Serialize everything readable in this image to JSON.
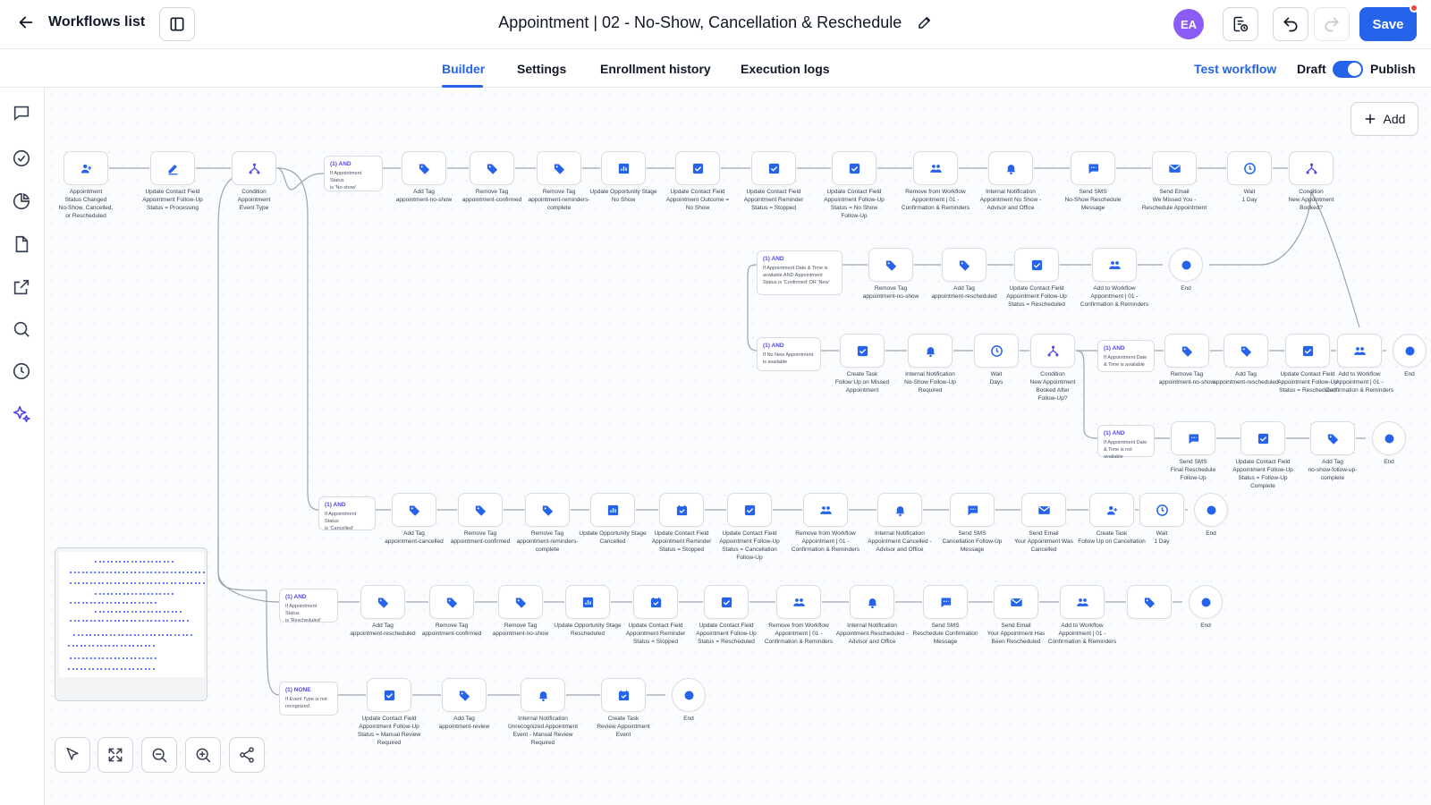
{
  "header": {
    "back_label": "Workflows list",
    "title": "Appointment | 02 - No-Show, Cancellation & Reschedule",
    "avatar_initials": "EA",
    "save_label": "Save"
  },
  "tabs": [
    {
      "label": "Builder",
      "active": true
    },
    {
      "label": "Settings",
      "active": false
    },
    {
      "label": "Enrollment history",
      "active": false
    },
    {
      "label": "Execution logs",
      "active": false
    }
  ],
  "actions": {
    "test_workflow": "Test workflow",
    "draft_label": "Draft",
    "publish_label": "Publish",
    "publish_toggle_on": true
  },
  "canvas": {
    "add_label": "Add"
  },
  "colors": {
    "accent": "#2563eb",
    "node_icon": "#2563eb",
    "condition": "#4f46e5",
    "avatar": "#8b5cf6",
    "notification_dot": "#ef4444"
  },
  "nodes": {
    "trigger": {
      "icon": "user-icon",
      "lines": [
        "Appointment",
        "Status Changed",
        "No-Show, Cancelled,",
        "or Rescheduled"
      ]
    },
    "set_processing": {
      "icon": "pencil-icon",
      "lines": [
        "Update Contact Field",
        "Appointment Follow-Up",
        "Status = Processing"
      ]
    },
    "cond_main": {
      "icon": "branch-icon",
      "lines": [
        "Condition",
        "Appointment",
        "Event Type"
      ]
    },
    "r1_cond": {
      "head": "(1) AND",
      "body": [
        "If Appointment Status",
        "is 'No-show'"
      ]
    },
    "r1": [
      {
        "icon": "tag-icon",
        "lines": [
          "Add Tag",
          "appointment-no-show"
        ]
      },
      {
        "icon": "tag-icon",
        "lines": [
          "Remove Tag",
          "appointment-confirmed"
        ]
      },
      {
        "icon": "tag-icon",
        "lines": [
          "Remove Tag",
          "appointment-reminders-",
          "complete"
        ]
      },
      {
        "icon": "chart-icon",
        "lines": [
          "Update Opportunity Stage",
          "No Show"
        ]
      },
      {
        "icon": "checkbox-icon",
        "lines": [
          "Update Contact Field",
          "Appointment Outcome =",
          "No Show"
        ]
      },
      {
        "icon": "checkbox-icon",
        "lines": [
          "Update Contact Field",
          "Appointment Reminder",
          "Status = Stopped"
        ]
      },
      {
        "icon": "checkbox-icon",
        "lines": [
          "Update Contact Field",
          "Appointment Follow-Up",
          "Status = No Show",
          "Follow-Up"
        ]
      },
      {
        "icon": "users-icon",
        "lines": [
          "Remove from Workflow",
          "Appointment | 01 -",
          "Confirmation & Reminders"
        ]
      },
      {
        "icon": "bell-icon",
        "lines": [
          "Internal Notification",
          "Appointment No Show -",
          "Advisor and Office"
        ]
      },
      {
        "icon": "sms-icon",
        "lines": [
          "Send SMS",
          "No-Show Reschedule",
          "Message"
        ]
      },
      {
        "icon": "mail-icon",
        "lines": [
          "Send Email",
          "We Missed You -",
          "Reschedule Appointment"
        ]
      },
      {
        "icon": "clock-icon",
        "lines": [
          "Wait",
          "1 Day"
        ]
      },
      {
        "icon": "branch-icon",
        "lines": [
          "Condition",
          "New Appointment",
          "Booked?"
        ]
      }
    ],
    "r2_cond": {
      "head": "(1) AND",
      "body": [
        "If Appointment Date & Time is",
        "available AND Appointment",
        "Status is 'Confirmed' OR 'New'"
      ]
    },
    "r2": [
      {
        "icon": "tag-icon",
        "lines": [
          "Remove Tag",
          "appointment-no-show"
        ]
      },
      {
        "icon": "tag-icon",
        "lines": [
          "Add Tag",
          "appointment-rescheduled"
        ]
      },
      {
        "icon": "checkbox-icon",
        "lines": [
          "Update Contact Field",
          "Appointment Follow-Up",
          "Status = Rescheduled"
        ]
      },
      {
        "icon": "users-icon",
        "lines": [
          "Add to Workflow",
          "Appointment | 01 -",
          "Confirmation & Reminders"
        ]
      },
      {
        "icon": "end-icon",
        "lines": [
          "End"
        ]
      }
    ],
    "r3_cond": {
      "head": "(1) AND",
      "body": [
        "If No New Appointment",
        "is available"
      ]
    },
    "r3": [
      {
        "icon": "checkbox-icon",
        "lines": [
          "Create Task",
          "Follow Up on Missed",
          "Appointment"
        ]
      },
      {
        "icon": "bell-icon",
        "lines": [
          "Internal Notification",
          "No-Show Follow-Up",
          "Required"
        ]
      },
      {
        "icon": "clock-icon",
        "lines": [
          "Wait",
          "Days"
        ]
      },
      {
        "icon": "branch-icon",
        "lines": [
          "Condition",
          "New Appointment",
          "Booked After",
          "Follow-Up?"
        ]
      }
    ],
    "r3a_cond": {
      "head": "(1) AND",
      "body": [
        "If Appointment Date",
        "& Time is available"
      ]
    },
    "r3a": [
      {
        "icon": "tag-icon",
        "lines": [
          "Remove Tag",
          "appointment-no-show"
        ]
      },
      {
        "icon": "tag-icon",
        "lines": [
          "Add Tag",
          "appointment-rescheduled"
        ]
      },
      {
        "icon": "checkbox-icon",
        "lines": [
          "Update Contact Field",
          "Appointment Follow-Up",
          "Status = Rescheduled"
        ]
      },
      {
        "icon": "users-icon",
        "lines": [
          "Add to Workflow",
          "Appointment | 01 -",
          "Confirmation & Reminders"
        ]
      },
      {
        "icon": "end-icon",
        "lines": [
          "End"
        ]
      }
    ],
    "r3b_cond": {
      "head": "(1) AND",
      "body": [
        "If Appointment Date",
        "& Time is not available"
      ]
    },
    "r3b": [
      {
        "icon": "sms-icon",
        "lines": [
          "Send SMS",
          "Final Reschedule",
          "Follow-Up"
        ]
      },
      {
        "icon": "checkbox-icon",
        "lines": [
          "Update Contact Field",
          "Appointment Follow-Up",
          "Status = Follow-Up",
          "Complete"
        ]
      },
      {
        "icon": "tag-icon",
        "lines": [
          "Add Tag",
          "no-show-follow-up-",
          "complete"
        ]
      },
      {
        "icon": "end-icon",
        "lines": [
          "End"
        ]
      }
    ],
    "r4_cond": {
      "head": "(1) AND",
      "body": [
        "If Appointment Status",
        "is 'Cancelled'"
      ]
    },
    "r4": [
      {
        "icon": "tag-icon",
        "lines": [
          "Add Tag",
          "appointment-cancelled"
        ]
      },
      {
        "icon": "tag-icon",
        "lines": [
          "Remove Tag",
          "appointment-confirmed"
        ]
      },
      {
        "icon": "tag-icon",
        "lines": [
          "Remove Tag",
          "appointment-reminders-",
          "complete"
        ]
      },
      {
        "icon": "chart-icon",
        "lines": [
          "Update Opportunity Stage",
          "Cancelled"
        ]
      },
      {
        "icon": "calendar-icon",
        "lines": [
          "Update Contact Field",
          "Appointment Reminder",
          "Status = Stopped"
        ]
      },
      {
        "icon": "checkbox-icon",
        "lines": [
          "Update Contact Field",
          "Appointment Follow-Up",
          "Status = Cancellation",
          "Follow-Up"
        ]
      },
      {
        "icon": "users-icon",
        "lines": [
          "Remove from Workflow",
          "Appointment | 01 -",
          "Confirmation & Reminders"
        ]
      },
      {
        "icon": "bell-icon",
        "lines": [
          "Internal Notification",
          "Appointment Cancelled -",
          "Advisor and Office"
        ]
      },
      {
        "icon": "sms-icon",
        "lines": [
          "Send SMS",
          "Cancellation Follow-Up",
          "Message"
        ]
      },
      {
        "icon": "mail-icon",
        "lines": [
          "Send Email",
          "Your Appointment Was",
          "Cancelled"
        ]
      },
      {
        "icon": "user-icon",
        "lines": [
          "Create Task",
          "Follow Up on Cancellation"
        ]
      },
      {
        "icon": "clock-icon",
        "lines": [
          "Wait",
          "1 Day"
        ]
      },
      {
        "icon": "end-icon",
        "lines": [
          "End"
        ]
      }
    ],
    "r5_cond": {
      "head": "(1) AND",
      "body": [
        "If Appointment Status",
        "is 'Rescheduled'"
      ]
    },
    "r5": [
      {
        "icon": "tag-icon",
        "lines": [
          "Add Tag",
          "appointment-rescheduled"
        ]
      },
      {
        "icon": "tag-icon",
        "lines": [
          "Remove Tag",
          "appointment-confirmed"
        ]
      },
      {
        "icon": "tag-icon",
        "lines": [
          "Remove Tag",
          "appointment-no-show"
        ]
      },
      {
        "icon": "chart-icon",
        "lines": [
          "Update Opportunity Stage",
          "Rescheduled"
        ]
      },
      {
        "icon": "calendar-icon",
        "lines": [
          "Update Contact Field",
          "Appointment Reminder",
          "Status = Stopped"
        ]
      },
      {
        "icon": "checkbox-icon",
        "lines": [
          "Update Contact Field",
          "Appointment Follow-Up",
          "Status = Rescheduled"
        ]
      },
      {
        "icon": "users-icon",
        "lines": [
          "Remove from Workflow",
          "Appointment | 01 -",
          "Confirmation & Reminders"
        ]
      },
      {
        "icon": "bell-icon",
        "lines": [
          "Internal Notification",
          "Appointment Rescheduled -",
          "Advisor and Office"
        ]
      },
      {
        "icon": "sms-icon",
        "lines": [
          "Send SMS",
          "Reschedule Confirmation",
          "Message"
        ]
      },
      {
        "icon": "mail-icon",
        "lines": [
          "Send Email",
          "Your Appointment Has",
          "Been Rescheduled"
        ]
      },
      {
        "icon": "users-icon",
        "lines": [
          "Add to Workflow",
          "Appointment | 01 -",
          "Confirmation & Reminders"
        ]
      },
      {
        "icon": "tag-icon",
        "lines": [
          ""
        ]
      },
      {
        "icon": "end-icon",
        "lines": [
          "End"
        ]
      }
    ],
    "r6_cond": {
      "head": "(1) NONE",
      "body": [
        "If Event Type is not",
        "recognized"
      ]
    },
    "r6": [
      {
        "icon": "checkbox-icon",
        "lines": [
          "Update Contact Field",
          "Appointment Follow-Up",
          "Status = Manual Review",
          "Required"
        ]
      },
      {
        "icon": "tag-icon",
        "lines": [
          "Add Tag",
          "appointment-review"
        ]
      },
      {
        "icon": "bell-icon",
        "lines": [
          "Internal Notification",
          "Unrecognized Appointment",
          "Event - Manual Review",
          "Required"
        ]
      },
      {
        "icon": "calendar-icon",
        "lines": [
          "Create Task",
          "Review Appointment",
          "Event"
        ]
      },
      {
        "icon": "end-icon",
        "lines": [
          "End"
        ]
      }
    ]
  }
}
